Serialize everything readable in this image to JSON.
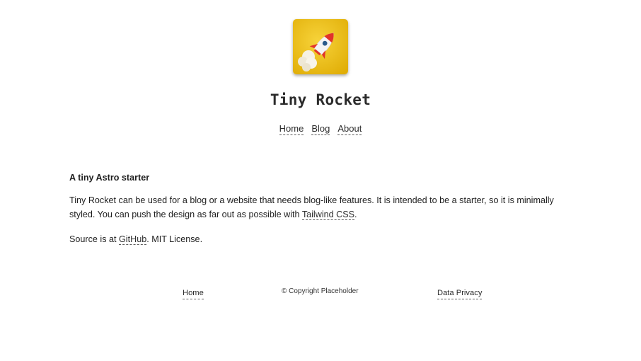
{
  "header": {
    "logo_icon": "rocket-logo-icon",
    "title": "Tiny Rocket",
    "nav": [
      {
        "label": "Home"
      },
      {
        "label": "Blog"
      },
      {
        "label": "About"
      }
    ]
  },
  "main": {
    "heading": "A tiny Astro starter",
    "intro_text": "Tiny Rocket can be used for a blog or a website that needs blog-like features. It is intended to be a starter, so it is minimally styled. You can push the design as far out as possible with ",
    "intro_link": "Tailwind CSS",
    "intro_end": ".",
    "source_text": "Source is at ",
    "source_link": "GitHub",
    "source_end": ". MIT License."
  },
  "footer": {
    "home_label": "Home",
    "copyright": "© Copyright Placeholder",
    "privacy_label": "Data Privacy"
  },
  "colors": {
    "logo_bg": "#f0c21a",
    "rocket_red": "#e2332a",
    "link_underline": "#5c5c5c"
  }
}
